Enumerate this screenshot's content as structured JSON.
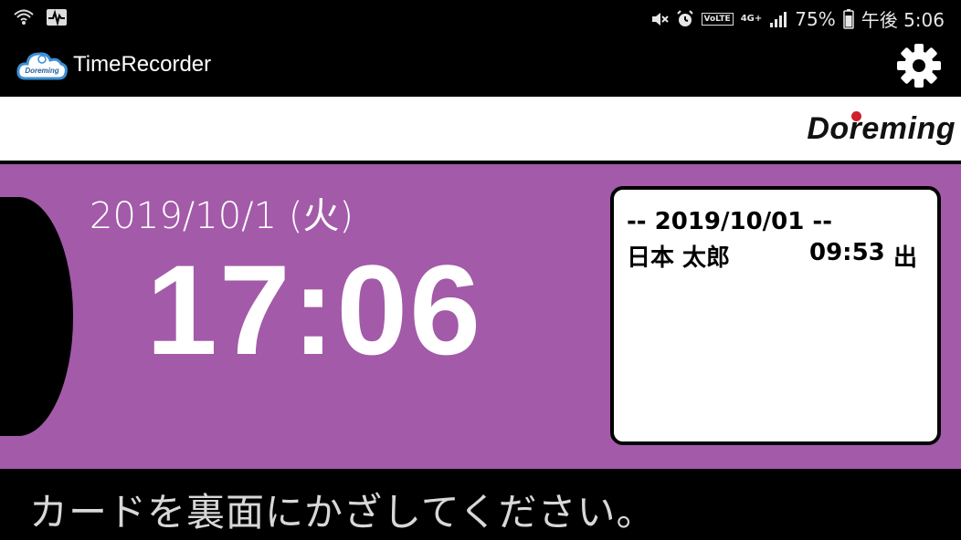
{
  "status_bar": {
    "left_icons": [
      "wifi-calling-icon",
      "activity-icon"
    ],
    "right_icons": [
      "mute-icon",
      "alarm-icon",
      "volte-icon",
      "network-4g-icon",
      "signal-icon",
      "battery-icon"
    ],
    "volte_label": "VoLTE",
    "network_label": "4G+",
    "battery_percent": "75%",
    "time": "午後 5:06"
  },
  "app_bar": {
    "logo_text": "Doreming",
    "title": "TimeRecorder",
    "settings_icon": "gear-icon"
  },
  "brand": {
    "logo_text": "Doreming",
    "accent_color": "#d11f2f"
  },
  "main": {
    "background_color": "#a35aa9",
    "date": "2019/10/1 (火)",
    "clock": "17:06",
    "log": {
      "header": "-- 2019/10/01 --",
      "entries": [
        {
          "name": "日本 太郎",
          "time": "09:53",
          "type": "出"
        }
      ]
    }
  },
  "footer": {
    "message": "カードを裏面にかざしてください。"
  }
}
